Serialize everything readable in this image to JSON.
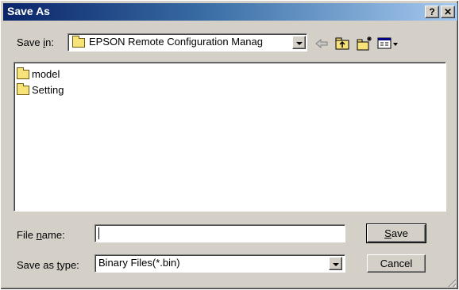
{
  "window": {
    "title": "Save As",
    "help_label": "?",
    "close_label": "✕"
  },
  "save_in": {
    "label_prefix": "Save ",
    "label_accel": "i",
    "label_suffix": "n:",
    "value": "EPSON Remote Configuration Manag"
  },
  "toolbar": {
    "icons": [
      "back-arrow-icon",
      "up-folder-icon",
      "new-folder-icon",
      "view-menu-icon"
    ]
  },
  "files": [
    {
      "name": "model",
      "icon": "folder-icon"
    },
    {
      "name": "Setting",
      "icon": "folder-icon"
    }
  ],
  "file_name": {
    "label_prefix": "File ",
    "label_accel": "n",
    "label_suffix": "ame:",
    "value": ""
  },
  "save_as_type": {
    "label_prefix": "Save as ",
    "label_accel": "t",
    "label_suffix": "ype:",
    "value": "Binary Files(*.bin)"
  },
  "buttons": {
    "save_accel": "S",
    "save_rest": "ave",
    "cancel": "Cancel"
  }
}
